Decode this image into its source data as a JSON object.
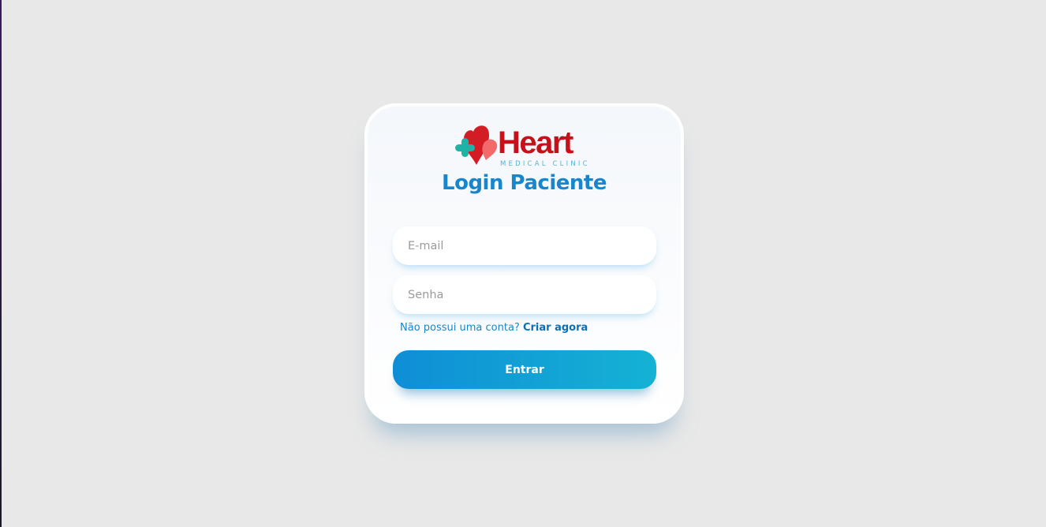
{
  "logo": {
    "wordmark": "Heart",
    "tagline": "MEDICAL CLINIC",
    "icon": "heart-cross-icon"
  },
  "page": {
    "title": "Login Paciente"
  },
  "form": {
    "email_placeholder": "E-mail",
    "password_placeholder": "Senha",
    "signup_prompt": "Não possui uma conta?",
    "signup_link": "Criar agora",
    "submit_label": "Entrar"
  },
  "colors": {
    "background": "#e8e8e8",
    "brand_red": "#c8101a",
    "accent_blue": "#1786cc",
    "cross_teal": "#1fb3a8",
    "button_gradient_start": "#0f8ed6",
    "button_gradient_end": "#15b2d4"
  }
}
